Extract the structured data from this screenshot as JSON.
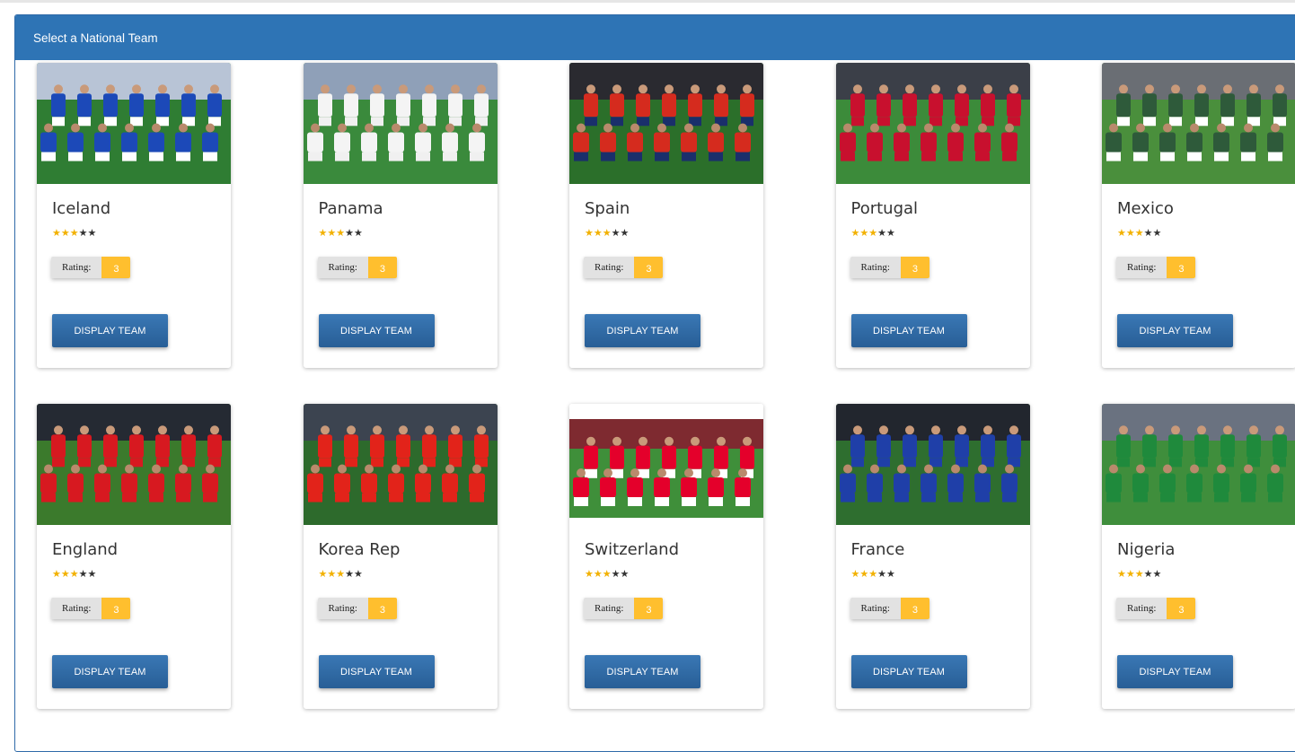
{
  "panel": {
    "title": "Select a National Team"
  },
  "teams": [
    {
      "name": "Iceland",
      "stars": 3,
      "rating_label": "Rating:",
      "rating_value": "3",
      "button": "DISPLAY TEAM",
      "kit": "#1c49b8",
      "shorts": "#ffffff",
      "pitch": "#2f7d33",
      "stand": "#b8c4d6"
    },
    {
      "name": "Panama",
      "stars": 3,
      "rating_label": "Rating:",
      "rating_value": "3",
      "button": "DISPLAY TEAM",
      "kit": "#f4f4f4",
      "shorts": "#f0f0f0",
      "pitch": "#3a8a3c",
      "stand": "#8fa0b8"
    },
    {
      "name": "Spain",
      "stars": 3,
      "rating_label": "Rating:",
      "rating_value": "3",
      "button": "DISPLAY TEAM",
      "kit": "#d52b1e",
      "shorts": "#1a2f6b",
      "pitch": "#2b6f2a",
      "stand": "#2a2a30"
    },
    {
      "name": "Portugal",
      "stars": 3,
      "rating_label": "Rating:",
      "rating_value": "3",
      "button": "DISPLAY TEAM",
      "kit": "#c8102e",
      "shorts": "#c8102e",
      "pitch": "#3c8b3a",
      "stand": "#3b3f48"
    },
    {
      "name": "Mexico",
      "stars": 3,
      "rating_label": "Rating:",
      "rating_value": "3",
      "button": "DISPLAY TEAM",
      "kit": "#2e5a3a",
      "shorts": "#ffffff",
      "pitch": "#4a8f3c",
      "stand": "#6a6e74"
    },
    {
      "name": "England",
      "stars": 3,
      "rating_label": "Rating:",
      "rating_value": "3",
      "button": "DISPLAY TEAM",
      "kit": "#d71920",
      "shorts": "#d71920",
      "pitch": "#3b7a2c",
      "stand": "#252a33"
    },
    {
      "name": "Korea Rep",
      "stars": 3,
      "rating_label": "Rating:",
      "rating_value": "3",
      "button": "DISPLAY TEAM",
      "kit": "#e2231a",
      "shorts": "#e2231a",
      "pitch": "#2d6a2c",
      "stand": "#3c4450"
    },
    {
      "name": "Switzerland",
      "stars": 3,
      "rating_label": "Rating:",
      "rating_value": "3",
      "button": "DISPLAY TEAM",
      "kit": "#e4002b",
      "shorts": "#ffffff",
      "pitch": "#3f8f3a",
      "stand": "#7e2a30"
    },
    {
      "name": "France",
      "stars": 3,
      "rating_label": "Rating:",
      "rating_value": "3",
      "button": "DISPLAY TEAM",
      "kit": "#1f3fa8",
      "shorts": "#1f3fa8",
      "pitch": "#2e6e2f",
      "stand": "#22262e"
    },
    {
      "name": "Nigeria",
      "stars": 3,
      "rating_label": "Rating:",
      "rating_value": "3",
      "button": "DISPLAY TEAM",
      "kit": "#1f8a3c",
      "shorts": "#1f8a3c",
      "pitch": "#3f8e3c",
      "stand": "#6a7280"
    }
  ]
}
